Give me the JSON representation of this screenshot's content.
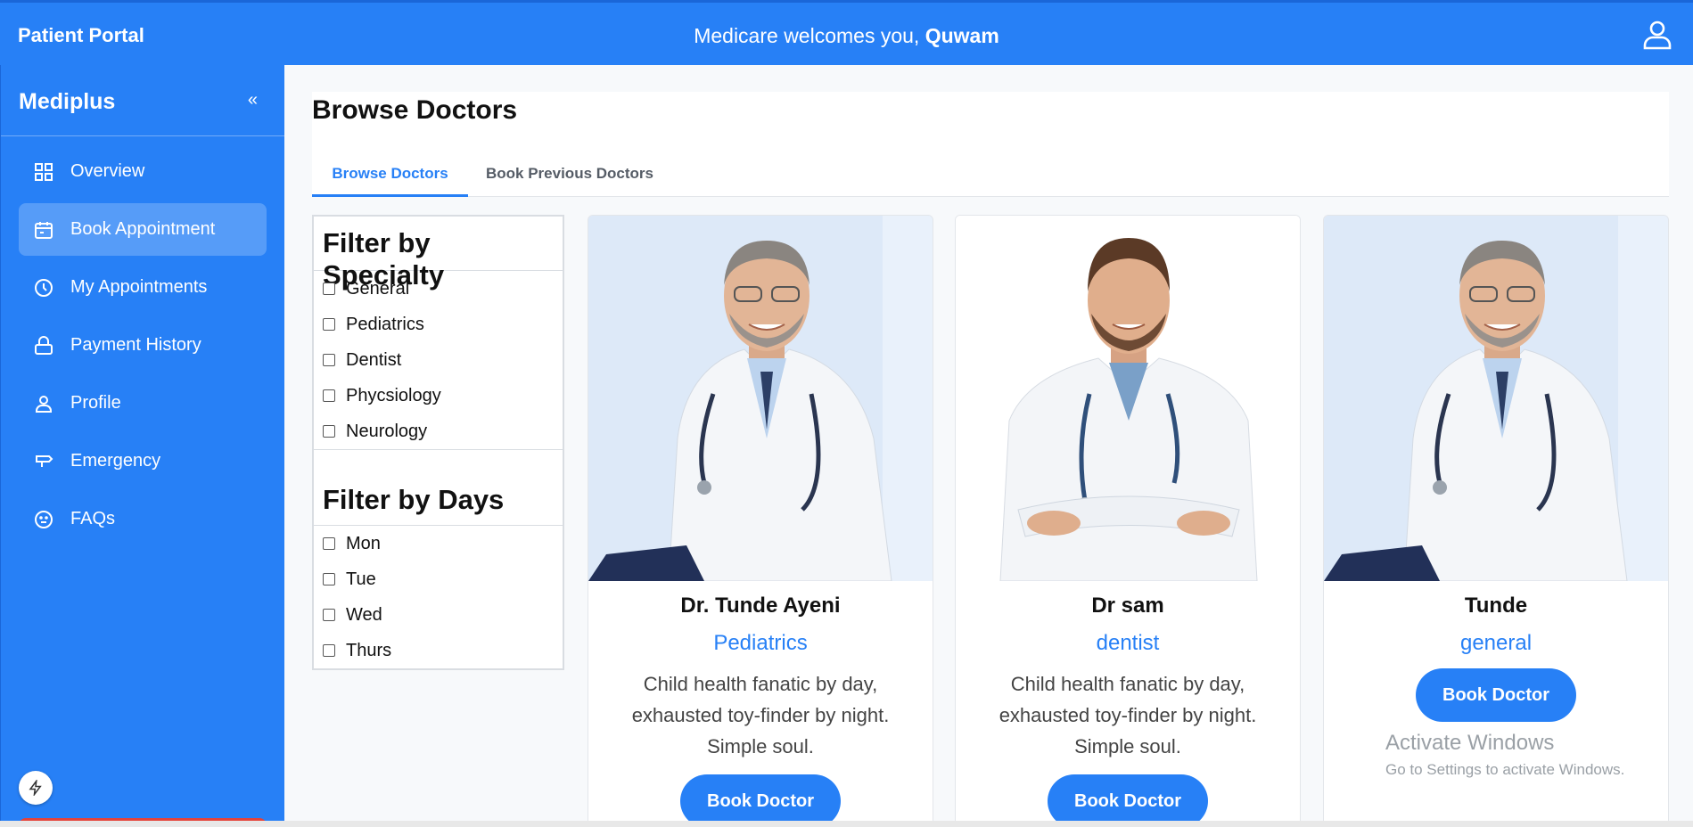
{
  "topbar": {
    "brand": "Patient Portal",
    "welcome_prefix": "Medicare welcomes you, ",
    "username": "Quwam"
  },
  "sidebar": {
    "logo": "Mediplus",
    "collapse_glyph": "«",
    "items": [
      {
        "label": "Overview",
        "icon": "grid-icon",
        "active": false
      },
      {
        "label": "Book Appointment",
        "icon": "calendar-icon",
        "active": true
      },
      {
        "label": "My Appointments",
        "icon": "clock-icon",
        "active": false
      },
      {
        "label": "Payment History",
        "icon": "lock-icon",
        "active": false
      },
      {
        "label": "Profile",
        "icon": "user-icon",
        "active": false
      },
      {
        "label": "Emergency",
        "icon": "signpost-icon",
        "active": false
      },
      {
        "label": "FAQs",
        "icon": "smiley-icon",
        "active": false
      }
    ]
  },
  "main": {
    "title": "Browse Doctors",
    "tabs": [
      {
        "label": "Browse Doctors",
        "active": true
      },
      {
        "label": "Book Previous Doctors",
        "active": false
      }
    ]
  },
  "filters": {
    "specialty_title": "Filter by Specialty",
    "specialties": [
      "General",
      "Pediatrics",
      "Dentist",
      "Phycsiology",
      "Neurology"
    ],
    "days_title": "Filter by Days",
    "days": [
      "Mon",
      "Tue",
      "Wed",
      "Thurs"
    ]
  },
  "doctors": [
    {
      "name": "Dr. Tunde Ayeni",
      "specialty": "Pediatrics",
      "bio": "Child health fanatic by day, exhausted toy-finder by night. Simple soul.",
      "button": "Book Doctor"
    },
    {
      "name": "Dr sam",
      "specialty": "dentist",
      "bio": "Child health fanatic by day, exhausted toy-finder by night. Simple soul.",
      "button": "Book Doctor"
    },
    {
      "name": "Tunde",
      "specialty": "general",
      "bio": "",
      "button": "Book Doctor"
    }
  ],
  "watermark": {
    "line1": "Activate Windows",
    "line2": "Go to Settings to activate Windows."
  },
  "colors": {
    "primary": "#2780f6",
    "logout": "#e4433a"
  }
}
